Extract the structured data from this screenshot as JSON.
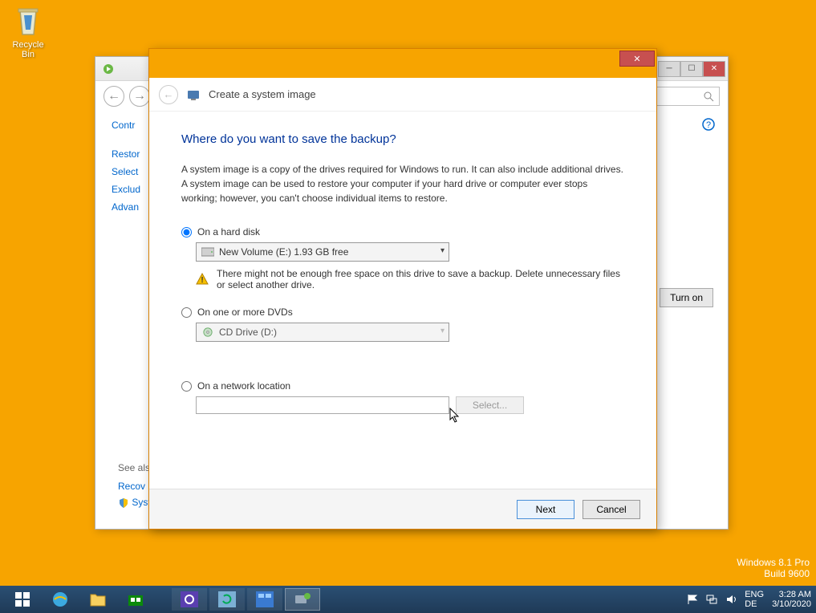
{
  "desktop": {
    "recycle_bin": "Recycle Bin"
  },
  "explorer": {
    "links": [
      "Contr",
      "Restor",
      "Select",
      "Exclud",
      "Advan"
    ],
    "see_also_label": "See als",
    "see_also": [
      "Recov",
      "Syster"
    ],
    "turn_on": "Turn on"
  },
  "wizard": {
    "title": "Create a system image",
    "heading": "Where do you want to save the backup?",
    "description": "A system image is a copy of the drives required for Windows to run. It can also include additional drives. A system image can be used to restore your computer if your hard drive or computer ever stops working; however, you can't choose individual items to restore.",
    "option_hard_disk": "On a hard disk",
    "hard_disk_value": "New Volume (E:)  1.93 GB free",
    "warning": "There might not be enough free space on this drive to save a backup. Delete unnecessary files or select another drive.",
    "option_dvd": "On one or more DVDs",
    "dvd_value": "CD Drive (D:)",
    "option_network": "On a network location",
    "select_button": "Select...",
    "next_button": "Next",
    "cancel_button": "Cancel"
  },
  "watermark": {
    "line1": "Windows 8.1 Pro",
    "line2": "Build 9600"
  },
  "taskbar": {
    "lang1": "ENG",
    "lang2": "DE",
    "time": "3:28 AM",
    "date": "3/10/2020"
  }
}
